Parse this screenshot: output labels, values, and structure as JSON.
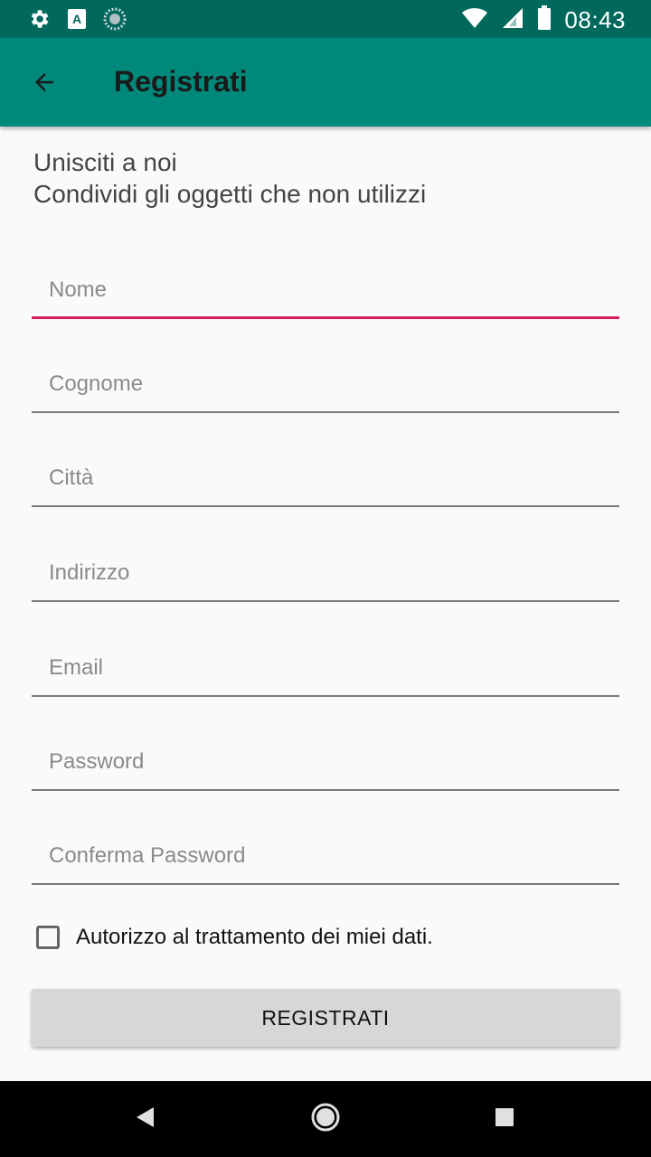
{
  "status_bar": {
    "time": "08:43",
    "icons": [
      "settings-icon",
      "keyboard-a-icon",
      "loading-icon",
      "wifi-icon",
      "signal-icon",
      "battery-icon"
    ]
  },
  "app_bar": {
    "title": "Registrati",
    "background": "#00897b",
    "back_icon": "arrow-back-icon"
  },
  "intro": {
    "line1": "Unisciti a noi",
    "line2": "Condividi gli oggetti che non utilizzi"
  },
  "form": {
    "fields": [
      {
        "placeholder": "Nome",
        "value": ""
      },
      {
        "placeholder": "Cognome",
        "value": ""
      },
      {
        "placeholder": "Città",
        "value": ""
      },
      {
        "placeholder": "Indirizzo",
        "value": ""
      },
      {
        "placeholder": "Email",
        "value": ""
      },
      {
        "placeholder": "Password",
        "value": ""
      },
      {
        "placeholder": "Conferma Password",
        "value": ""
      }
    ],
    "consent_label": "Autorizzo al trattamento dei miei dati.",
    "consent_checked": false,
    "submit_label": "REGISTRATI",
    "accent_color": "#d81b60"
  },
  "nav_bar": {
    "icons": [
      "back-triangle-icon",
      "home-circle-icon",
      "recents-square-icon"
    ]
  }
}
